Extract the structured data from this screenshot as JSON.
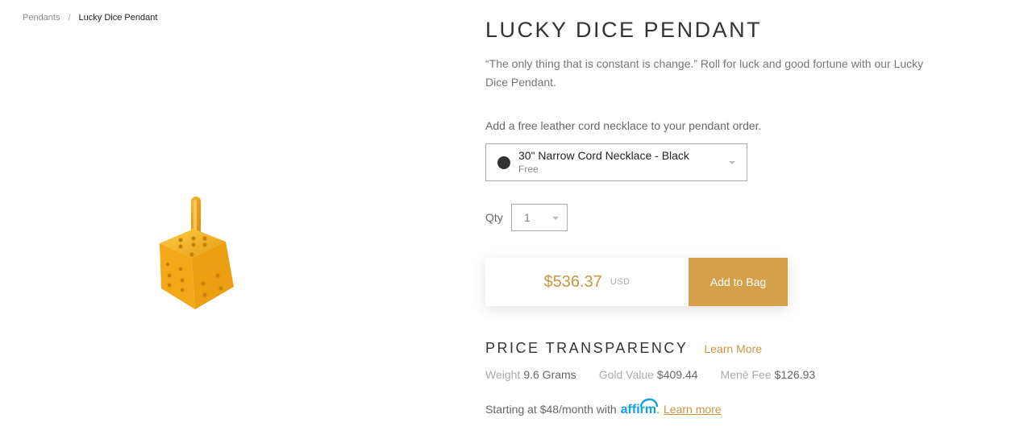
{
  "breadcrumb": {
    "parent": "Pendants",
    "separator": "/",
    "current": "Lucky Dice Pendant"
  },
  "product": {
    "title": "LUCKY DICE PENDANT",
    "description": "“The only thing that is constant is change.” Roll for luck and good fortune with our Lucky Dice Pendant."
  },
  "cord": {
    "label": "Add a free leather cord necklace to your pendant order.",
    "selected_name": "30\" Narrow Cord Necklace - Black",
    "selected_price": "Free",
    "swatch_color": "#333333"
  },
  "qty": {
    "label": "Qty",
    "value": "1"
  },
  "buy": {
    "price": "$536.37",
    "currency": "USD",
    "button": "Add to Bag"
  },
  "price_transparency": {
    "heading": "PRICE TRANSPARENCY",
    "learn_more": "Learn More",
    "weight_label": "Weight",
    "weight_value": "9.6 Grams",
    "gold_label": "Gold Value",
    "gold_value": "$409.44",
    "fee_label": "Menē Fee",
    "fee_value": "$126.93"
  },
  "financing": {
    "text": "Starting at $48/month with",
    "logo_text": "affirm",
    "suffix": ".",
    "learn_more": "Learn more"
  },
  "colors": {
    "accent": "#d4a04a",
    "price": "#c9953e",
    "affirm": "#0fa0ea"
  }
}
